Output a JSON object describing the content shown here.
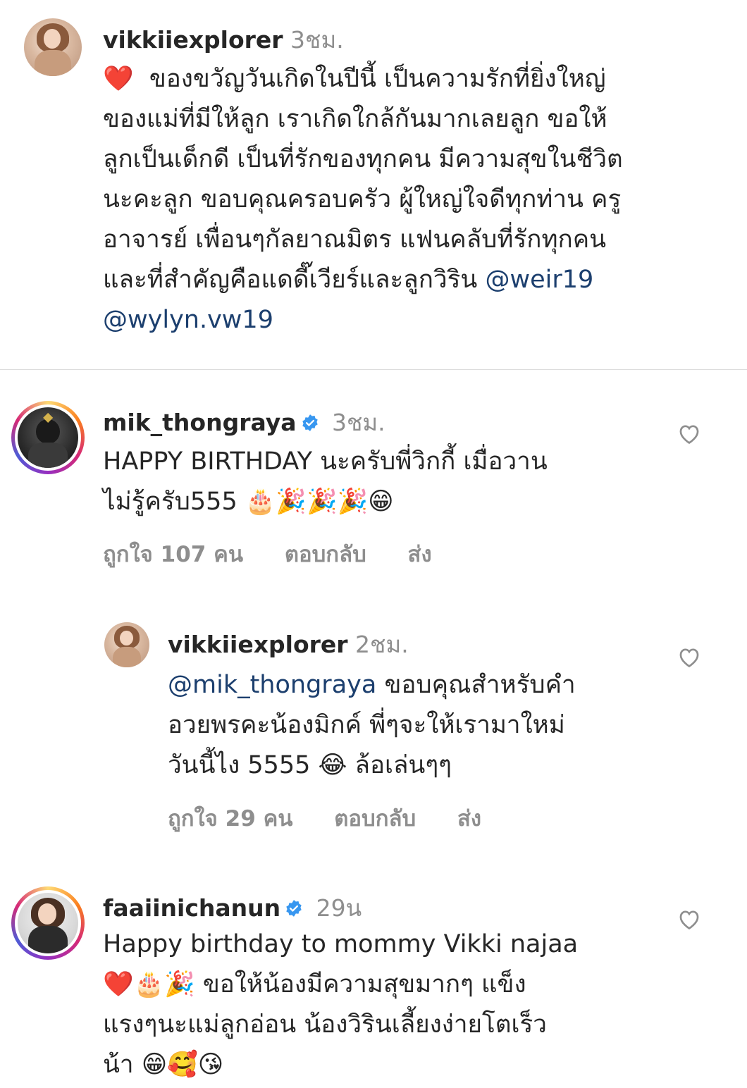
{
  "caption": {
    "username": "vikkiiexplorer",
    "time": "3ชม.",
    "emoji": "❤️",
    "lines": [
      "ของขวัญวันเกิดในปีนี้ เป็นความรักที่ยิ่งใหญ่",
      "ของแม่ที่มีให้ลูก เราเกิดใกล้กันมากเลยลูก ขอให้",
      "ลูกเป็นเด็กดี เป็นที่รักของทุกคน มีความสุขในชีวิต",
      "นะคะลูก ขอบคุณครอบครัว ผู้ใหญ่ใจดีทุกท่าน ครู",
      "อาจารย์ เพื่อนๆกัลยาณมิตร แฟนคลับที่รักทุกคน",
      "และที่สำคัญคือแดดี๊เวียร์และลูกวิริน"
    ],
    "mention1": "@weir19",
    "mention2": "@wylyn.vw19"
  },
  "comments": [
    {
      "username": "mik_thongraya",
      "time": "3ชม.",
      "line1": "HAPPY BIRTHDAY นะครับพี่วิกกี้ เมื่อวาน",
      "line2": "ไม่รู้ครับ555 🎂🎉🎉🎉😁",
      "likes": "ถูกใจ 107 คน",
      "reply": "ตอบกลับ",
      "send": "ส่ง"
    },
    {
      "username": "vikkiiexplorer",
      "time": "2ชม.",
      "mention": "@mik_thongraya",
      "line1_rest": " ขอบคุณสำหรับคำ",
      "line2": "อวยพรคะน้องมิกค์ พี่ๆจะให้เรามาใหม่",
      "line3": "วันนี้ไง 5555 😂 ล้อเล่นๆๆ",
      "likes": "ถูกใจ 29 คน",
      "reply": "ตอบกลับ",
      "send": "ส่ง"
    },
    {
      "username": "faaiinichanun",
      "time": "29น",
      "line1": "Happy birthday to mommy Vikki najaa",
      "line2": "❤️🎂🎉 ขอให้น้องมีความสุขมากๆ แข็ง",
      "line3": "แรงๆนะแม่ลูกอ่อน น้องวิรินเลี้ยงง่ายโตเร็ว",
      "line4": "น้า 😁🥰😘"
    }
  ],
  "colors": {
    "text": "#262626",
    "muted": "#8e8e8e",
    "mention": "#1c3f6e",
    "verified": "#3897f0"
  },
  "icons": [
    "heart-outline-icon",
    "verified-badge-icon"
  ]
}
